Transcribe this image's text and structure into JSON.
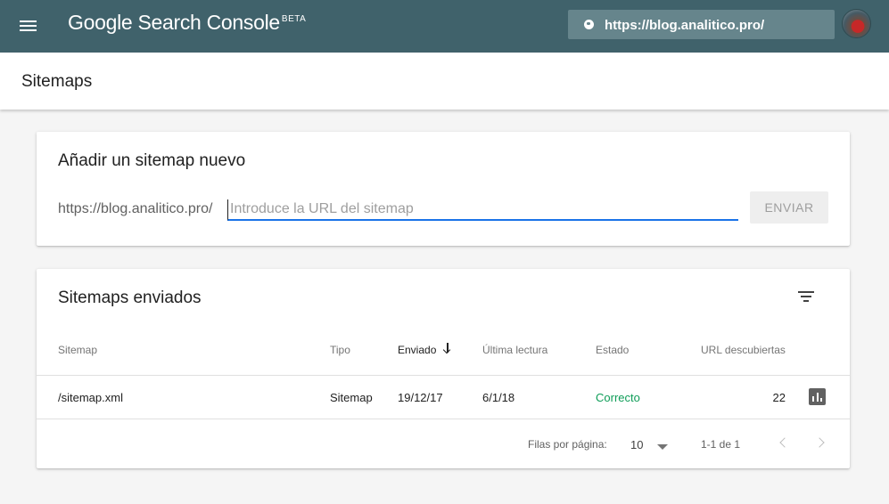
{
  "appbar": {
    "brand": "Google Search Console",
    "badge": "BETA",
    "property_url": "https://blog.analitico.pro/",
    "bg_color": "#40626b"
  },
  "page": {
    "title": "Sitemaps"
  },
  "add_sitemap": {
    "title": "Añadir un sitemap nuevo",
    "prefix": "https://blog.analitico.pro/",
    "input_value": "",
    "input_placeholder": "Introduce la URL del sitemap",
    "submit_label": "ENVIAR"
  },
  "submitted": {
    "title": "Sitemaps enviados",
    "columns": {
      "sitemap": "Sitemap",
      "tipo": "Tipo",
      "enviado": "Enviado",
      "ultima_lectura": "Última lectura",
      "estado": "Estado",
      "url_descubiertas": "URL descubiertas"
    },
    "sorted_column": "enviado",
    "rows": [
      {
        "sitemap": "/sitemap.xml",
        "tipo": "Sitemap",
        "enviado": "19/12/17",
        "ultima_lectura": "6/1/18",
        "estado": "Correcto",
        "url_descubiertas": "22"
      }
    ],
    "pagination": {
      "rows_label": "Filas por página:",
      "rows_per_page": "10",
      "range": "1-1 de 1"
    },
    "status_color": "#0f9d58"
  }
}
